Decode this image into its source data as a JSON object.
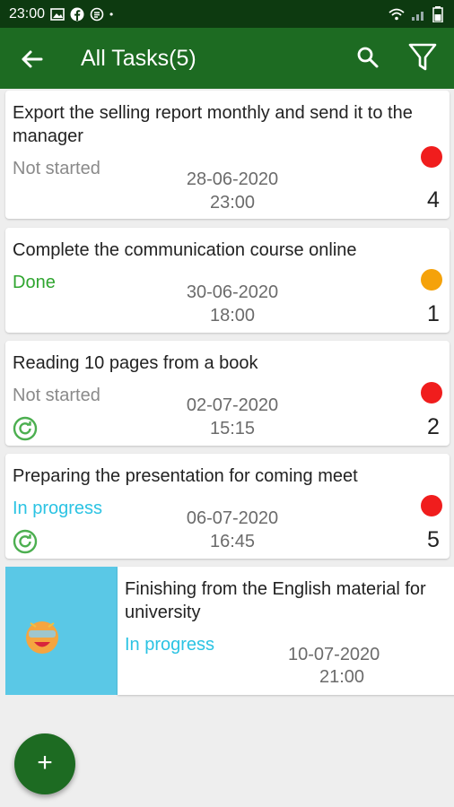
{
  "status_bar": {
    "time": "23:00"
  },
  "app_bar": {
    "title": "All Tasks(5)",
    "back_icon": "arrow-left",
    "search_icon": "search",
    "filter_icon": "funnel"
  },
  "tasks": [
    {
      "name": "Export the selling report monthly and send it to the manager",
      "status": "Not started",
      "status_color": "#8a8a8a",
      "date": "28-06-2020",
      "time": "23:00",
      "priority_color": "#f01d1d",
      "priority": "4",
      "repeat": false
    },
    {
      "name": "Complete the communication course online",
      "status": "Done",
      "status_color": "#2fa52f",
      "date": "30-06-2020",
      "time": "18:00",
      "priority_color": "#f5a20a",
      "priority": "1",
      "repeat": false
    },
    {
      "name": "Reading 10 pages from a book",
      "status": "Not started",
      "status_color": "#8a8a8a",
      "date": "02-07-2020",
      "time": "15:15",
      "priority_color": "#f01d1d",
      "priority": "2",
      "repeat": true
    },
    {
      "name": "Preparing the presentation for coming meet",
      "status": "In progress",
      "status_color": "#2bc3e3",
      "date": "06-07-2020",
      "time": "16:45",
      "priority_color": "#f01d1d",
      "priority": "5",
      "repeat": true
    },
    {
      "name": "Finishing from the English material for university",
      "status": "In progress",
      "status_color": "#2bc3e3",
      "date": "10-07-2020",
      "time": "21:00",
      "repeat": false,
      "swiped": true
    }
  ],
  "swipe_action": {
    "background_color": "#5ac8e6",
    "icon": "party-emoji"
  },
  "fab": {
    "label": "+"
  },
  "colors": {
    "primary": "#1d6b22",
    "status_bar": "#0d3a10"
  }
}
